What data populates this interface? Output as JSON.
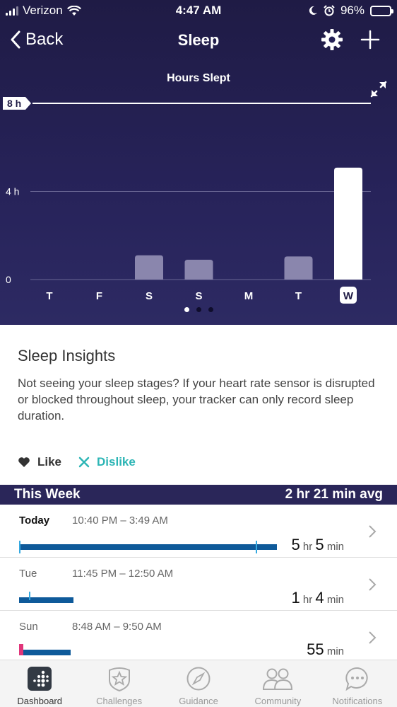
{
  "status_bar": {
    "carrier": "Verizon",
    "time": "4:47 AM",
    "battery": "96%",
    "battery_level": 0.96
  },
  "nav": {
    "back_label": "Back",
    "title": "Sleep"
  },
  "chart_data": {
    "type": "bar",
    "title": "Hours Slept",
    "categories": [
      "T",
      "F",
      "S",
      "S",
      "M",
      "T",
      "W"
    ],
    "values": [
      0,
      0,
      1.1,
      0.9,
      0,
      1.05,
      5.08
    ],
    "selected_index": 6,
    "ylim": [
      0,
      8
    ],
    "yticks": [
      {
        "value": 0,
        "label": "0"
      },
      {
        "value": 4,
        "label": "4 h"
      },
      {
        "value": 8,
        "label": "8 h"
      }
    ],
    "goal": 8,
    "colors": {
      "bar": "#8a86ad",
      "selected": "#ffffff",
      "grid": "#6a6794"
    }
  },
  "pager": {
    "count": 3,
    "active": 0
  },
  "insights": {
    "title": "Sleep Insights",
    "body": "Not seeing your sleep stages? If your heart rate sensor is disrupted or blocked throughout sleep, your tracker can only record sleep duration.",
    "like_label": "Like",
    "dislike_label": "Dislike"
  },
  "week": {
    "title": "This Week",
    "avg": "2 hr 21 min avg",
    "rows": [
      {
        "day": "Today",
        "range": "10:40 PM – 3:49 AM",
        "hr": "5",
        "hr_unit": "hr",
        "min": "5",
        "min_unit": "min"
      },
      {
        "day": "Tue",
        "range": "11:45 PM – 12:50 AM",
        "hr": "1",
        "hr_unit": "hr",
        "min": "4",
        "min_unit": "min"
      },
      {
        "day": "Sun",
        "range": "8:48 AM – 9:50 AM",
        "hr": "",
        "hr_unit": "",
        "min": "55",
        "min_unit": "min"
      }
    ]
  },
  "tabs": [
    {
      "label": "Dashboard",
      "icon": "dashboard-icon"
    },
    {
      "label": "Challenges",
      "icon": "challenges-icon"
    },
    {
      "label": "Guidance",
      "icon": "compass-icon"
    },
    {
      "label": "Community",
      "icon": "community-icon"
    },
    {
      "label": "Notifications",
      "icon": "chat-bubble-icon"
    }
  ]
}
